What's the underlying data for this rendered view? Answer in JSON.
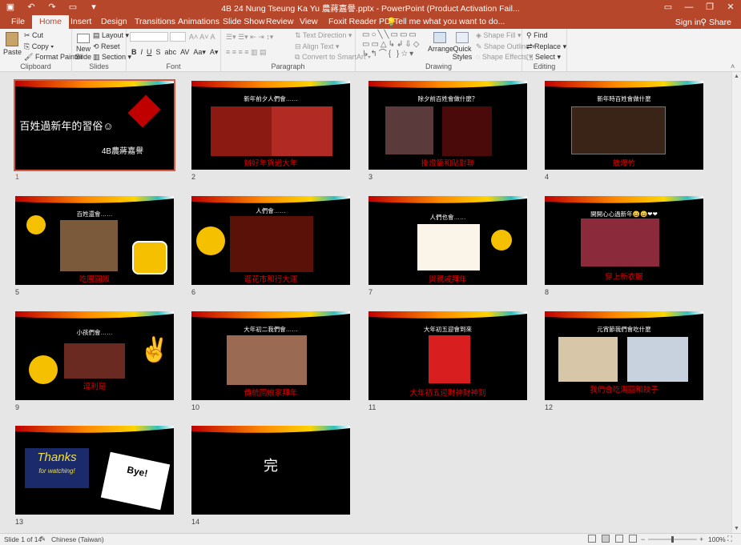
{
  "window": {
    "title": "4B 24 Nung Tseung Ka Yu 農蔣嘉譽.pptx - PowerPoint (Product Activation Fail...",
    "sign_in": "Sign in",
    "share": "Share"
  },
  "tabs": [
    "File",
    "Home",
    "Insert",
    "Design",
    "Transitions",
    "Animations",
    "Slide Show",
    "Review",
    "View",
    "Foxit Reader PDF"
  ],
  "tell_me": "Tell me what you want to do...",
  "ribbon": {
    "clipboard": {
      "label": "Clipboard",
      "paste": "Paste",
      "cut": "Cut",
      "copy": "Copy",
      "format_painter": "Format Painter"
    },
    "slides": {
      "label": "Slides",
      "new_slide": "New Slide",
      "layout": "Layout",
      "reset": "Reset",
      "section": "Section"
    },
    "font": {
      "label": "Font"
    },
    "paragraph": {
      "label": "Paragraph",
      "text_direction": "Text Direction",
      "align_text": "Align Text",
      "convert_smartart": "Convert to SmartArt"
    },
    "drawing": {
      "label": "Drawing",
      "arrange": "Arrange",
      "quick_styles": "Quick Styles",
      "shape_fill": "Shape Fill",
      "shape_outline": "Shape Outline",
      "shape_effects": "Shape Effects"
    },
    "editing": {
      "label": "Editing",
      "find": "Find",
      "replace": "Replace",
      "select": "Select"
    }
  },
  "slides": [
    {
      "n": "1",
      "title": "百姓過新年的習俗☺",
      "subtitle": "4B農蔣嘉譽",
      "caption": ""
    },
    {
      "n": "2",
      "title": "新年前夕人們會……",
      "caption": "辦好年貨過大年"
    },
    {
      "n": "3",
      "title": "除夕前百姓會做什麼？",
      "caption": "掛燈籠和貼對聯"
    },
    {
      "n": "4",
      "title": "新年時百姓會做什麼",
      "caption": "放爆竹"
    },
    {
      "n": "5",
      "title": "百姓還會……",
      "caption": "吃團圓飯"
    },
    {
      "n": "6",
      "title": "人們會……",
      "caption": "逛花市和行大運"
    },
    {
      "n": "7",
      "title": "人們也會……",
      "caption": "與親戚拜年"
    },
    {
      "n": "8",
      "title": "開開心心過新年😀😀❤❤",
      "caption": "穿上新衣服"
    },
    {
      "n": "9",
      "title": "小孩們會……",
      "caption": "逗利是"
    },
    {
      "n": "10",
      "title": "大年初二我們會……",
      "caption": "傳統回娘家拜年"
    },
    {
      "n": "11",
      "title": "大年初五迎會到來",
      "caption": "大年初五迎財神財神到"
    },
    {
      "n": "12",
      "title": "元宵節我們會吃什麼",
      "caption": "我們會吃湯圓和餃子"
    },
    {
      "n": "13",
      "title": "",
      "caption": "",
      "thanks": "Thanks",
      "thanks_sub": "for watching!",
      "bye": "Bye!"
    },
    {
      "n": "14",
      "title": "完",
      "caption": ""
    }
  ],
  "status": {
    "slide_of": "Slide 1 of 14",
    "language": "Chinese (Taiwan)",
    "zoom": "100%"
  }
}
